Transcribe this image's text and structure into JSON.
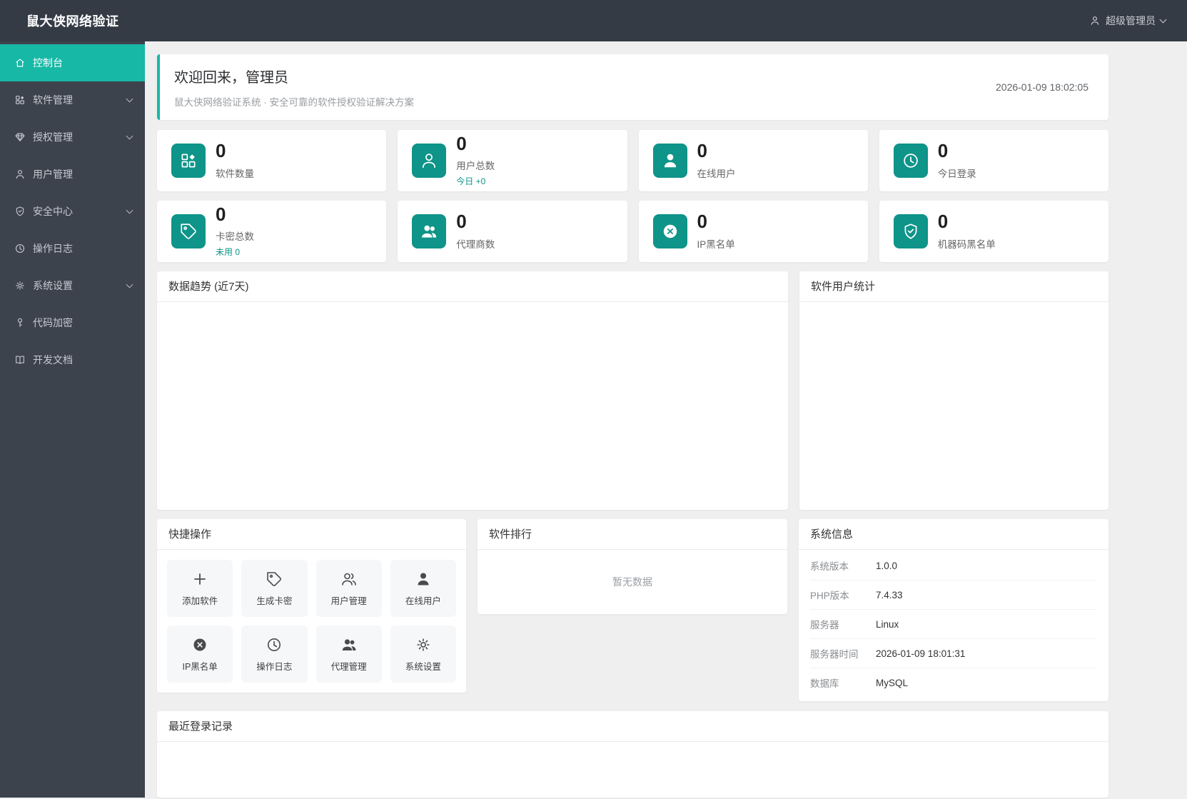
{
  "topbar": {
    "brand": "鼠大侠网络验证",
    "user_label": "超级管理员"
  },
  "sidebar": {
    "items": [
      {
        "label": "控制台",
        "icon": "home-icon",
        "active": true,
        "expandable": false
      },
      {
        "label": "软件管理",
        "icon": "apps-icon",
        "active": false,
        "expandable": true
      },
      {
        "label": "授权管理",
        "icon": "gem-icon",
        "active": false,
        "expandable": true
      },
      {
        "label": "用户管理",
        "icon": "user-icon",
        "active": false,
        "expandable": false
      },
      {
        "label": "安全中心",
        "icon": "shield-check-icon",
        "active": false,
        "expandable": true
      },
      {
        "label": "操作日志",
        "icon": "clock-icon",
        "active": false,
        "expandable": false
      },
      {
        "label": "系统设置",
        "icon": "gear-icon",
        "active": false,
        "expandable": true
      },
      {
        "label": "代码加密",
        "icon": "key-icon",
        "active": false,
        "expandable": false
      },
      {
        "label": "开发文档",
        "icon": "book-icon",
        "active": false,
        "expandable": false
      }
    ]
  },
  "welcome": {
    "title": "欢迎回来，管理员",
    "subtitle": "鼠大侠网络验证系统 · 安全可靠的软件授权验证解决方案",
    "timestamp": "2026-01-09 18:02:05"
  },
  "stats": [
    {
      "value": "0",
      "label": "软件数量",
      "icon": "apps-icon"
    },
    {
      "value": "0",
      "label": "用户总数",
      "sub": "今日 +0",
      "icon": "user-outline-icon"
    },
    {
      "value": "0",
      "label": "在线用户",
      "icon": "user-filled-icon"
    },
    {
      "value": "0",
      "label": "今日登录",
      "icon": "clock-icon"
    },
    {
      "value": "0",
      "label": "卡密总数",
      "sub": "未用 0",
      "icon": "tag-icon"
    },
    {
      "value": "0",
      "label": "代理商数",
      "icon": "users-filled-icon"
    },
    {
      "value": "0",
      "label": "IP黑名单",
      "icon": "x-circle-icon"
    },
    {
      "value": "0",
      "label": "机器码黑名单",
      "icon": "shield-check-icon"
    }
  ],
  "trend_panel": {
    "title": "数据趋势 (近7天)"
  },
  "software_users_panel": {
    "title": "软件用户统计"
  },
  "quick_actions": {
    "title": "快捷操作",
    "items": [
      {
        "label": "添加软件",
        "icon": "plus-icon"
      },
      {
        "label": "生成卡密",
        "icon": "tag-icon"
      },
      {
        "label": "用户管理",
        "icon": "users-outline-icon"
      },
      {
        "label": "在线用户",
        "icon": "user-filled-icon"
      },
      {
        "label": "IP黑名单",
        "icon": "x-circle-icon"
      },
      {
        "label": "操作日志",
        "icon": "clock-icon"
      },
      {
        "label": "代理管理",
        "icon": "users-filled-icon"
      },
      {
        "label": "系统设置",
        "icon": "gear-icon"
      }
    ]
  },
  "ranking_panel": {
    "title": "软件排行",
    "empty_text": "暂无数据"
  },
  "system_info": {
    "title": "系统信息",
    "rows": [
      {
        "label": "系统版本",
        "value": "1.0.0"
      },
      {
        "label": "PHP版本",
        "value": "7.4.33"
      },
      {
        "label": "服务器",
        "value": "Linux"
      },
      {
        "label": "服务器时间",
        "value": "2026-01-09 18:01:31"
      },
      {
        "label": "数据库",
        "value": "MySQL"
      }
    ]
  },
  "recent_logins_panel": {
    "title": "最近登录记录"
  },
  "colors": {
    "accent": "#17b8a6",
    "icon_tile": "#0e9488",
    "topbar_bg": "#353b45",
    "sidebar_bg": "#3d434d"
  }
}
